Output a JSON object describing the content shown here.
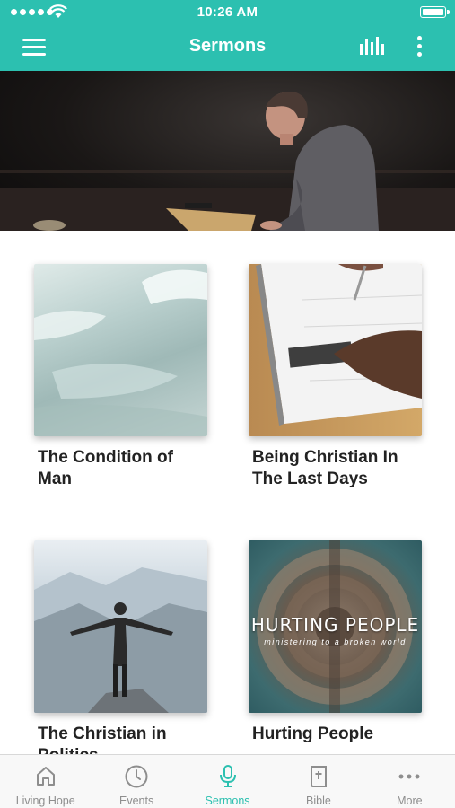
{
  "status_bar": {
    "time": "10:26 AM"
  },
  "header": {
    "title": "Sermons"
  },
  "sermons": [
    {
      "title": "The Condition of Man"
    },
    {
      "title": "Being Christian In The Last Days"
    },
    {
      "title": "The Christian in Politics"
    },
    {
      "title": "Hurting People",
      "cover_title": "HURTING PEOPLE",
      "cover_subtitle": "ministering to a broken world"
    }
  ],
  "tabs": [
    {
      "label": "Living Hope",
      "icon": "home-icon"
    },
    {
      "label": "Events",
      "icon": "clock-icon"
    },
    {
      "label": "Sermons",
      "icon": "microphone-icon",
      "active": true
    },
    {
      "label": "Bible",
      "icon": "bible-icon"
    },
    {
      "label": "More",
      "icon": "more-dots-icon"
    }
  ],
  "colors": {
    "accent": "#2cc0b0",
    "tab_inactive": "#8e8e8e"
  }
}
